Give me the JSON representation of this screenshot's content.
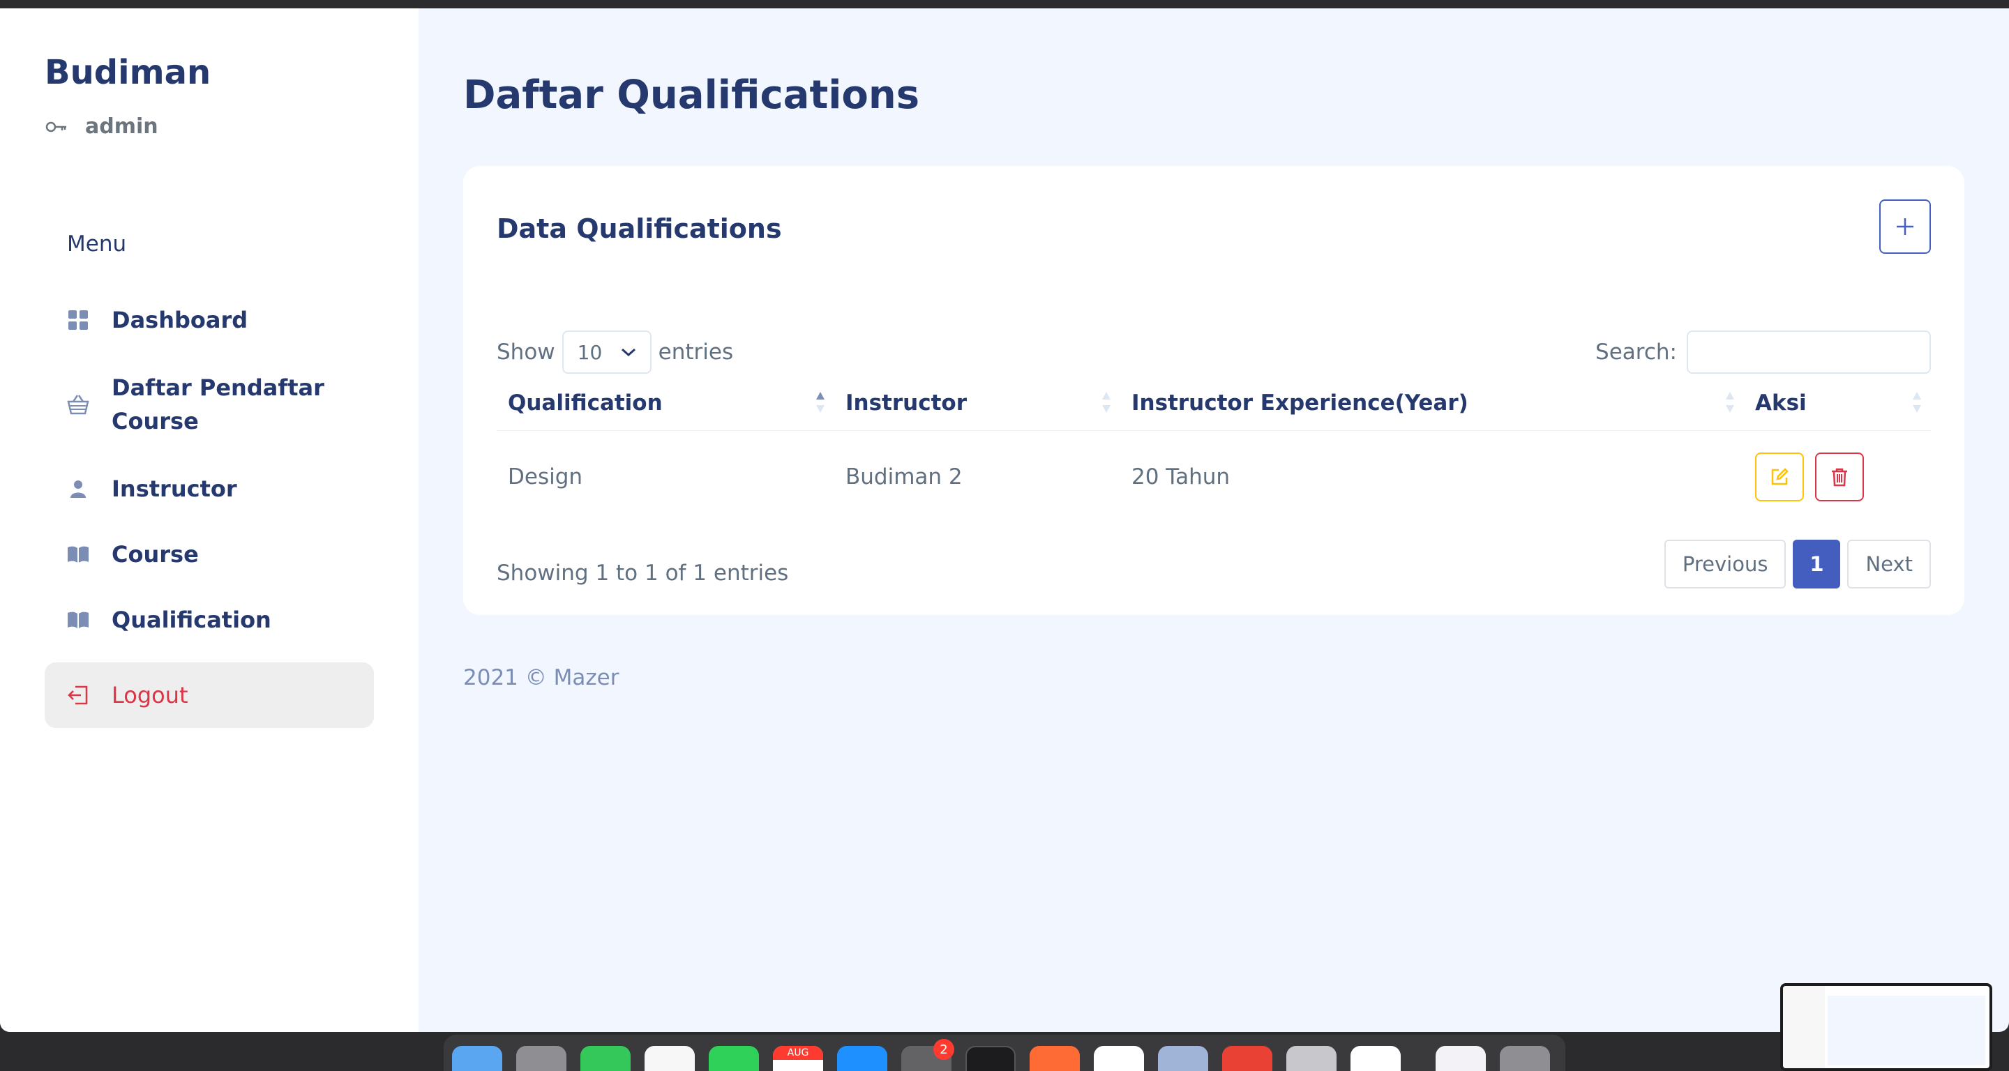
{
  "sidebar": {
    "brand": "Budiman",
    "role": "admin",
    "menu_title": "Menu",
    "items": [
      {
        "label": "Dashboard",
        "icon": "grid-icon"
      },
      {
        "label": "Daftar Pendaftar Course",
        "icon": "basket-icon"
      },
      {
        "label": "Instructor",
        "icon": "person-icon"
      },
      {
        "label": "Course",
        "icon": "book-icon"
      },
      {
        "label": "Qualification",
        "icon": "book-icon"
      }
    ],
    "logout": {
      "label": "Logout",
      "icon": "logout-icon"
    }
  },
  "main": {
    "page_title": "Daftar Qualifications",
    "card_title": "Data Qualifications",
    "show_label": "Show",
    "entries_value": "10",
    "entries_label": "entries",
    "search_label": "Search:",
    "search_value": "",
    "columns": [
      "Qualification",
      "Instructor",
      "Instructor Experience(Year)",
      "Aksi"
    ],
    "rows": [
      {
        "qualification": "Design",
        "instructor": "Budiman 2",
        "experience": "20 Tahun"
      }
    ],
    "info": "Showing 1 to 1 of 1 entries",
    "pagination": {
      "previous": "Previous",
      "current": "1",
      "next": "Next"
    },
    "footer": "2021 © Mazer"
  },
  "dock": {
    "calendar_month": "AUG",
    "settings_badge": "2"
  },
  "colors": {
    "primary": "#435ebe",
    "heading": "#25396f",
    "warning": "#ffc107",
    "danger": "#dc3545",
    "background": "#f2f7ff"
  }
}
